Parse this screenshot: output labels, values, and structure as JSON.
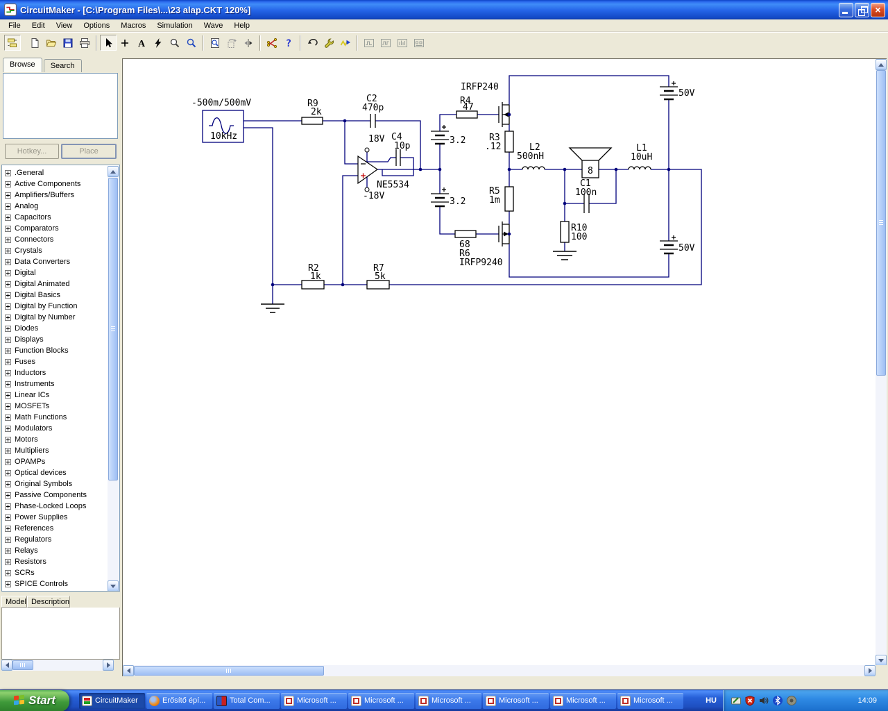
{
  "window": {
    "title": "CircuitMaker - [C:\\Program Files\\...\\23 alap.CKT 120%]",
    "controls": [
      "minimize",
      "restore",
      "close"
    ]
  },
  "menu": {
    "items": [
      {
        "label": "File"
      },
      {
        "label": "Edit"
      },
      {
        "label": "View"
      },
      {
        "label": "Options"
      },
      {
        "label": "Macros"
      },
      {
        "label": "Simulation"
      },
      {
        "label": "Wave"
      },
      {
        "label": "Help"
      }
    ]
  },
  "toolbar": {
    "buttons": [
      "browse-parts",
      "new-file",
      "open-file",
      "save-file",
      "print",
      "select-arrow",
      "draw-wire",
      "place-text",
      "delete-tool",
      "edit-probe",
      "zoom",
      "zoom-window",
      "rotate",
      "mirror",
      "digital-options",
      "help",
      "undo",
      "device-properties",
      "run-simulation",
      "oscilloscope",
      "digital-scope",
      "signal-generator",
      "logic-analyzer"
    ]
  },
  "sidebar": {
    "tabs": [
      {
        "label": "Browse",
        "active": true
      },
      {
        "label": "Search",
        "active": false
      }
    ],
    "hotkey_button": "Hotkey...",
    "place_button": "Place",
    "categories": [
      ".General",
      "Active Components",
      "Amplifiers/Buffers",
      "Analog",
      "Capacitors",
      "Comparators",
      "Connectors",
      "Crystals",
      "Data Converters",
      "Digital",
      "Digital Animated",
      "Digital Basics",
      "Digital by Function",
      "Digital by Number",
      "Diodes",
      "Displays",
      "Function Blocks",
      "Fuses",
      "Inductors",
      "Instruments",
      "Linear ICs",
      "MOSFETs",
      "Math Functions",
      "Modulators",
      "Motors",
      "Multipliers",
      "OPAMPs",
      "Optical devices",
      "Original Symbols",
      "Passive Components",
      "Phase-Locked Loops",
      "Power Supplies",
      "References",
      "Regulators",
      "Relays",
      "Resistors",
      "SCRs",
      "SPICE Controls"
    ],
    "model_columns": [
      {
        "label": "Model"
      },
      {
        "label": "Description"
      }
    ]
  },
  "schematic": {
    "labels": {
      "src_amp": "-500m/500mV",
      "src_freq": "10kHz",
      "r9_ref": "R9",
      "r9_val": "2k",
      "c2_ref": "C2",
      "c2_val": "470p",
      "c4_ref": "C4",
      "c4_val": "10p",
      "opamp_vplus": "18V",
      "opamp_vminus": "-18V",
      "opamp_part": "NE5534",
      "q1_part": "IRFP240",
      "r4_ref": "R4",
      "r4_val": "47",
      "r3_ref": "R3",
      "r3_val": ".12",
      "r5_ref": "R5",
      "r5_val": "1m",
      "r6_val": "68",
      "r6_ref": "R6",
      "q2_part": "IRFP9240",
      "bias1_val": "3.2",
      "bias2_val": "3.2",
      "l2_ref": "L2",
      "l2_val": "500nH",
      "speaker_val": "8",
      "c1_ref": "C1",
      "c1_val": "100n",
      "r10_ref": "R10",
      "r10_val": "100",
      "l1_ref": "L1",
      "l1_val": "10uH",
      "supply1_val": "50V",
      "supply2_val": "50V",
      "r2_ref": "R2",
      "r2_val": "1k",
      "r7_ref": "R7",
      "r7_val": "5k"
    }
  },
  "taskbar": {
    "start_label": "Start",
    "tasks": [
      {
        "label": "CircuitMaker",
        "icon": "circuitmaker",
        "active": true
      },
      {
        "label": "Erősítő épí...",
        "icon": "firefox",
        "active": false
      },
      {
        "label": "Total Com...",
        "icon": "totalcmd",
        "active": false
      },
      {
        "label": "Microsoft ...",
        "icon": "office",
        "active": false
      },
      {
        "label": "Microsoft ...",
        "icon": "office",
        "active": false
      },
      {
        "label": "Microsoft ...",
        "icon": "office",
        "active": false
      },
      {
        "label": "Microsoft ...",
        "icon": "office",
        "active": false
      },
      {
        "label": "Microsoft ...",
        "icon": "office",
        "active": false
      },
      {
        "label": "Microsoft ...",
        "icon": "office",
        "active": false
      }
    ],
    "language": "HU",
    "tray_icons": [
      "tablet-pen",
      "security-shield",
      "volume",
      "bluetooth",
      "audio-device"
    ],
    "clock": "14:09"
  }
}
